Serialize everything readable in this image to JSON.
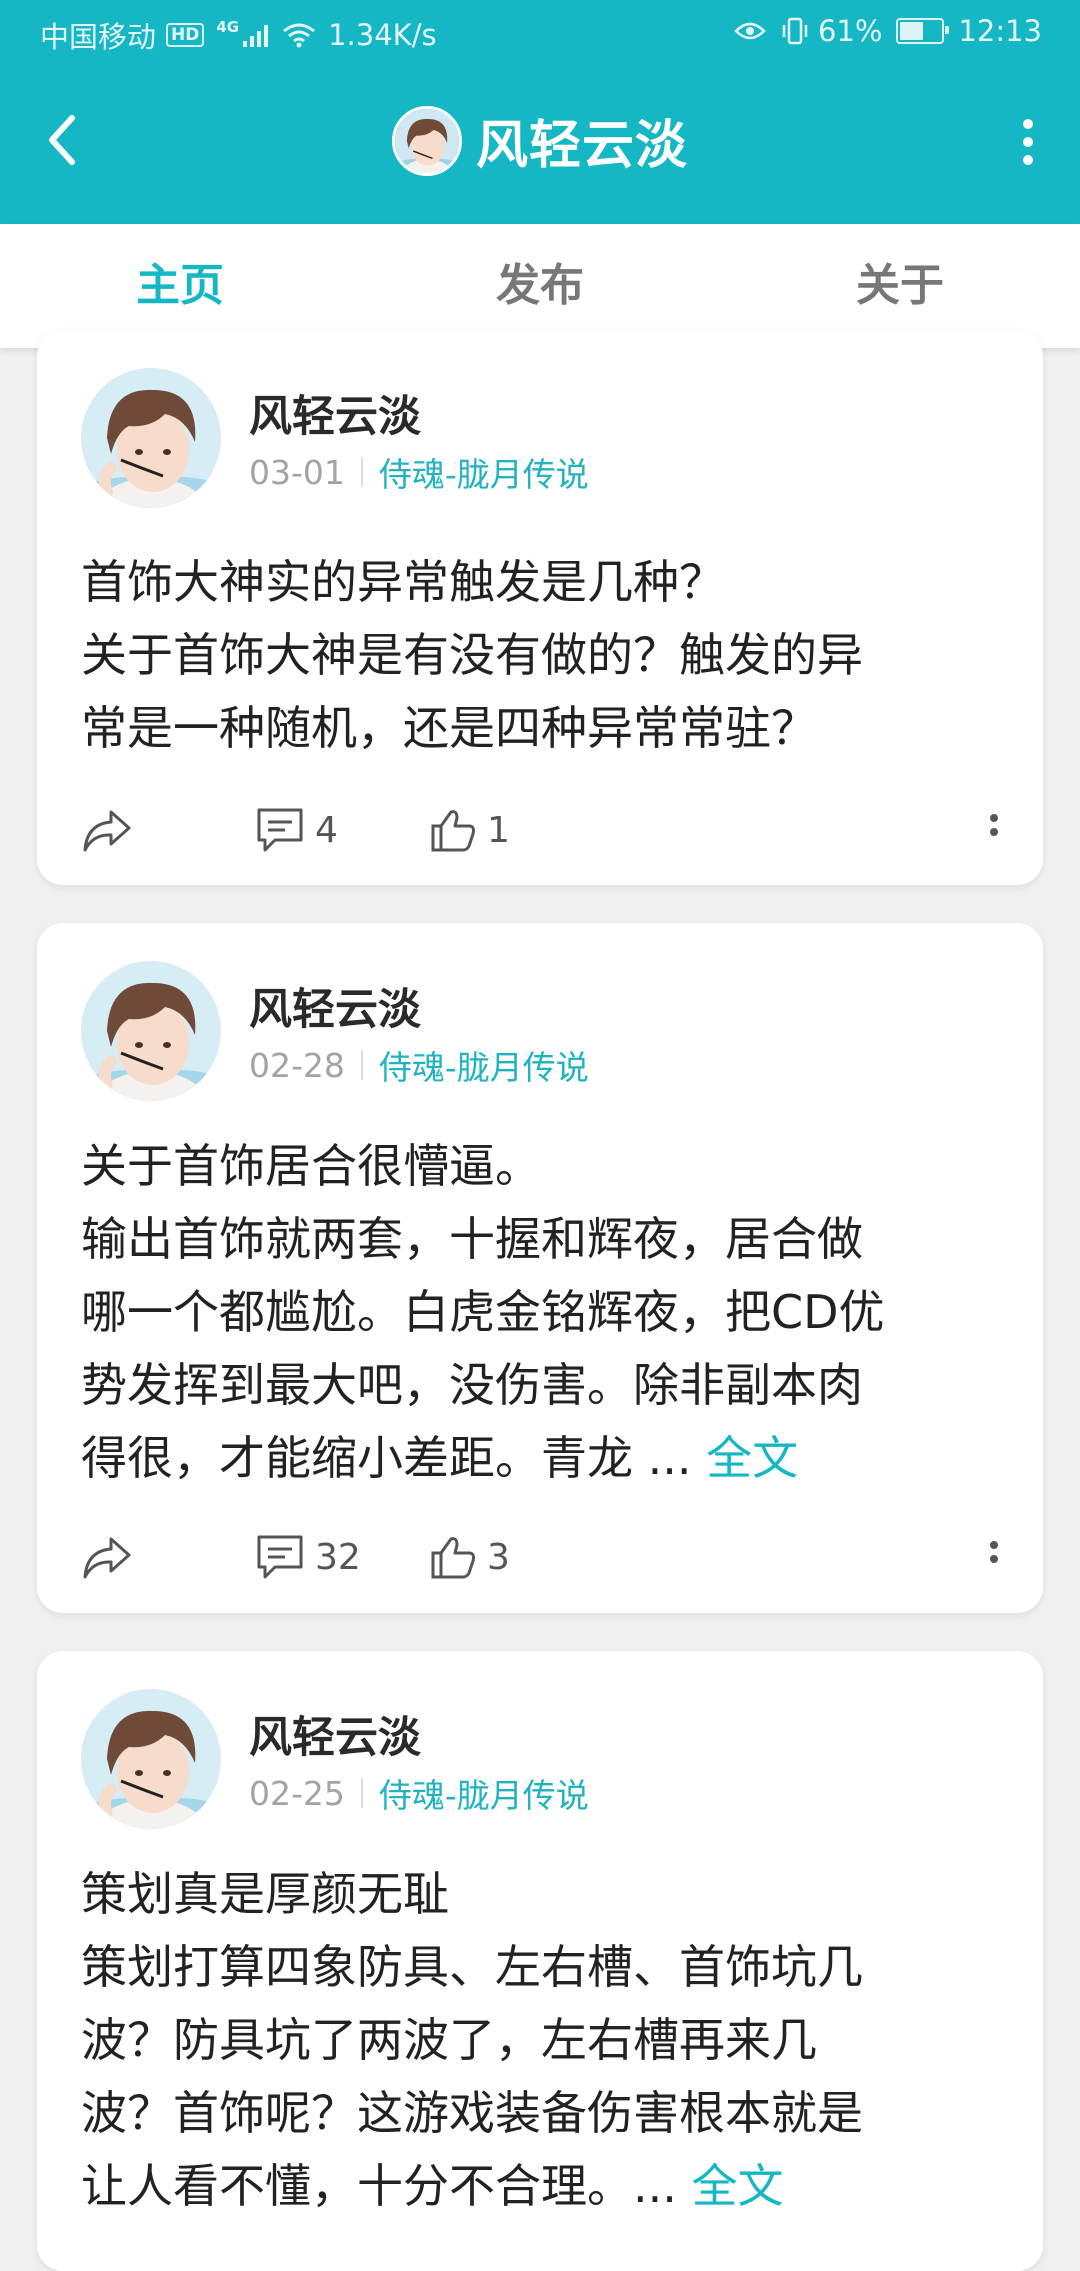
{
  "status_bar": {
    "carrier": "中国移动",
    "hd": "HD",
    "network": "4G",
    "speed": "1.34K/s",
    "battery_text": "61%",
    "battery_level": 0.61,
    "time": "12:13"
  },
  "header": {
    "title": "风轻云淡"
  },
  "tabs": [
    {
      "label": "主页",
      "active": true
    },
    {
      "label": "发布",
      "active": false
    },
    {
      "label": "关于",
      "active": false
    }
  ],
  "posts": [
    {
      "author": "风轻云淡",
      "date": "03-01",
      "game": "侍魂-胧月传说",
      "lines": [
        "首饰大神实的异常触发是几种？",
        "关于首饰大神是有没有做的？触发的异",
        "常是一种随机，还是四种异常常驻？"
      ],
      "last_line": "",
      "full_label": "",
      "comments": "4",
      "likes": "1"
    },
    {
      "author": "风轻云淡",
      "date": "02-28",
      "game": "侍魂-胧月传说",
      "lines": [
        "关于首饰居合很懵逼。",
        "输出首饰就两套，十握和辉夜，居合做",
        "哪一个都尴尬。白虎金铭辉夜，把CD优",
        "势发挥到最大吧，没伤害。除非副本肉"
      ],
      "last_line": "得很，才能缩小差距。青龙 ... ",
      "full_label": "全文",
      "comments": "32",
      "likes": "3"
    },
    {
      "author": "风轻云淡",
      "date": "02-25",
      "game": "侍魂-胧月传说",
      "lines": [
        "策划真是厚颜无耻",
        "策划打算四象防具、左右槽、首饰坑几",
        "波？防具坑了两波了，左右槽再来几",
        "波？首饰呢？这游戏装备伤害根本就是"
      ],
      "last_line": "让人看不懂，十分不合理。... ",
      "full_label": "全文",
      "comments": "",
      "likes": ""
    }
  ],
  "colors": {
    "accent": "#16b7c5",
    "link": "#22b3c0",
    "background": "#f0f0f0"
  },
  "icons": {
    "share": "share-icon",
    "comment": "comment-icon",
    "like": "thumbs-up-icon",
    "more": "more-vertical-icon",
    "back": "back-arrow-icon"
  }
}
